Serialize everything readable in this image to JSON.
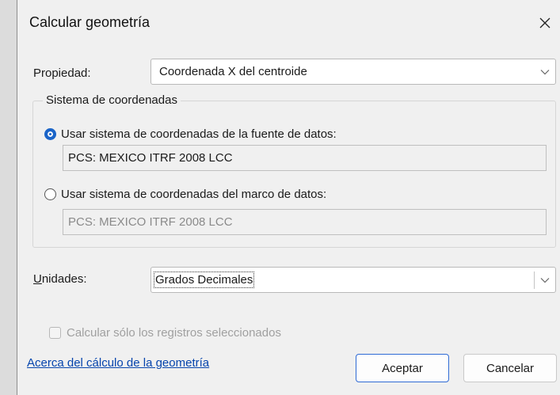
{
  "dialog": {
    "title": "Calcular geometría"
  },
  "property": {
    "label": "Propiedad:",
    "value": "Coordenada X del centroide"
  },
  "coordinate_system": {
    "legend": "Sistema de coordenadas",
    "source_option_label": "Usar sistema de coordenadas de la fuente de datos:",
    "source_selected": true,
    "source_value": "PCS: MEXICO ITRF 2008 LCC",
    "frame_option_label": "Usar sistema de coordenadas del marco de datos:",
    "frame_selected": false,
    "frame_value": "PCS: MEXICO ITRF 2008 LCC"
  },
  "units": {
    "label_mnemonic": "U",
    "label_rest": "nidades:",
    "value": "Grados Decimales"
  },
  "selected_only": {
    "label": "Calcular sólo los registros seleccionados",
    "checked": false,
    "enabled": false
  },
  "about_link": "Acerca del cálculo de la geometría",
  "buttons": {
    "ok": "Aceptar",
    "cancel": "Cancelar"
  },
  "icons": {
    "close": "close-icon",
    "dropdown": "chevron-down-icon"
  },
  "colors": {
    "accent": "#1a64c8",
    "link": "#0645ad",
    "primary_border": "#2f6bd5"
  }
}
